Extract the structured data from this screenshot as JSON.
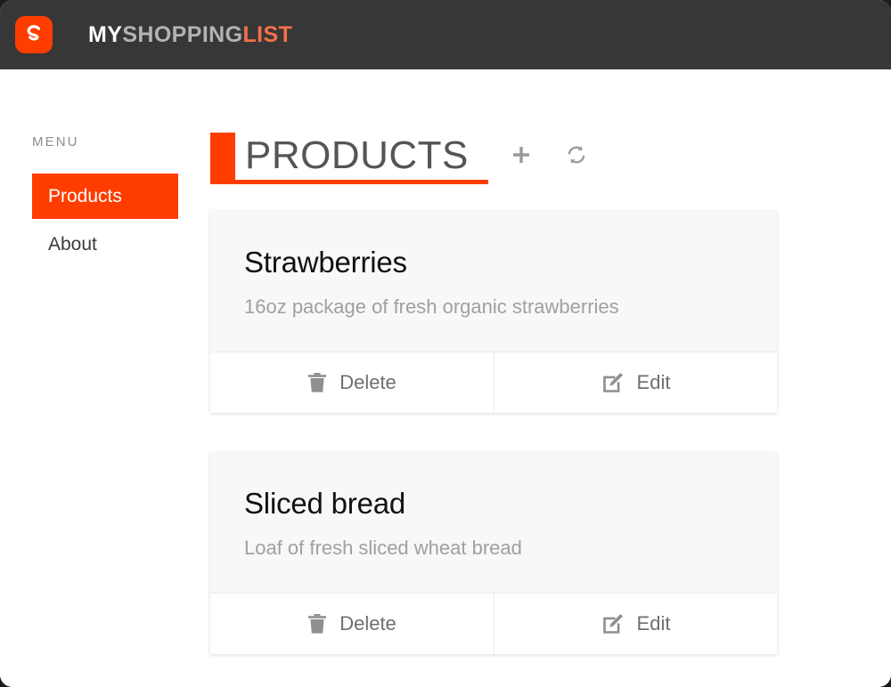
{
  "header": {
    "logo_icon": "s-logo-icon",
    "brand": {
      "part1": "MY",
      "part2": "SHOPPING",
      "part3": "LIST"
    },
    "background_color": "#373737",
    "accent_color": "#ff3d00"
  },
  "sidebar": {
    "label": "MENU",
    "items": [
      {
        "label": "Products",
        "active": true
      },
      {
        "label": "About",
        "active": false
      }
    ]
  },
  "main": {
    "title": "PRODUCTS",
    "actions": [
      {
        "name": "add-product-button",
        "icon": "plus-icon"
      },
      {
        "name": "refresh-button",
        "icon": "refresh-icon"
      }
    ],
    "products": [
      {
        "title": "Strawberries",
        "description": "16oz package of fresh organic strawberries",
        "delete_label": "Delete",
        "edit_label": "Edit"
      },
      {
        "title": "Sliced bread",
        "description": "Loaf of fresh sliced wheat bread",
        "delete_label": "Delete",
        "edit_label": "Edit"
      }
    ]
  }
}
